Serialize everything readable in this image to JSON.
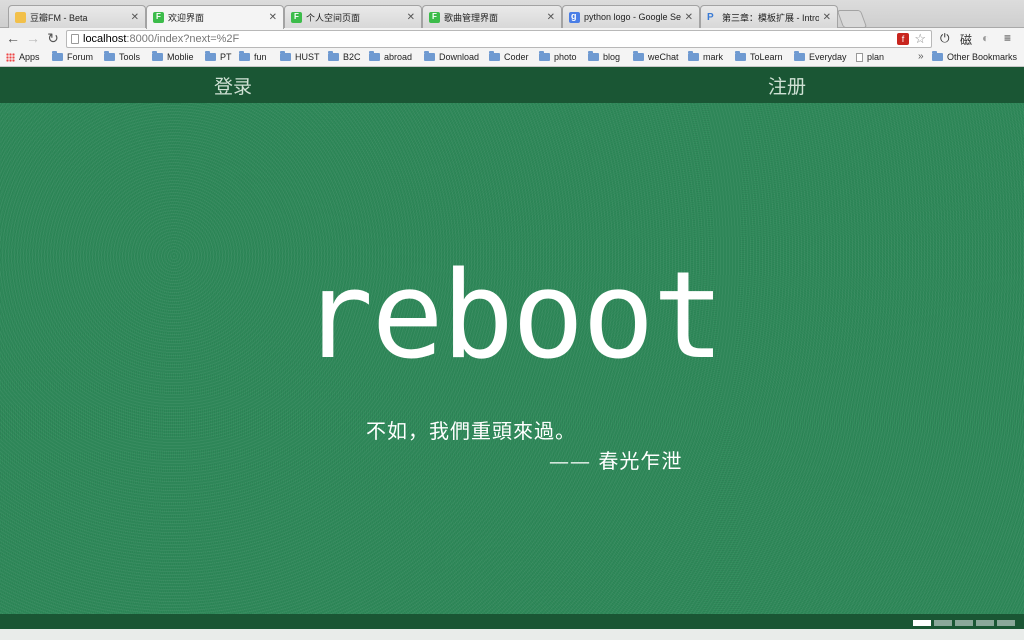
{
  "tabs": [
    {
      "label": "豆瓣FM - Beta",
      "favicon": "folder-favicon-icon",
      "active": false
    },
    {
      "label": "欢迎界面",
      "favicon": "feather-favicon-icon",
      "active": true
    },
    {
      "label": "个人空间页面",
      "favicon": "feather-favicon-icon",
      "active": false
    },
    {
      "label": "歌曲管理界面",
      "favicon": "feather-favicon-icon",
      "active": false
    },
    {
      "label": "python logo - Google Sear",
      "favicon": "google-favicon-icon",
      "active": false
    },
    {
      "label": "第三章：模板扩展 - Introdu",
      "favicon": "p-favicon-icon",
      "active": false
    }
  ],
  "toolbar": {
    "url_host": "localhost",
    "url_path": ":8000/index?next=%2F",
    "extension_text": "磁"
  },
  "bookmarks": {
    "items": [
      "Apps",
      "Forum",
      "Tools",
      "Moblie",
      "PT",
      "fun",
      "HUST",
      "B2C",
      "abroad",
      "Download",
      "Coder",
      "photo",
      "blog",
      "weChat",
      "mark",
      "ToLearn",
      "Everyday",
      "plan"
    ],
    "more": "»",
    "other": "Other Bookmarks"
  },
  "page": {
    "login": "登录",
    "register": "注册",
    "hero": "reboot",
    "quote": "不如，我們重頭來過。",
    "quote_source": "—— 春光乍泄",
    "pager_count": 5,
    "pager_active": 0
  },
  "colors": {
    "background": "#2f8a5a",
    "bar": "#1a5634",
    "text": "#ffffff"
  }
}
